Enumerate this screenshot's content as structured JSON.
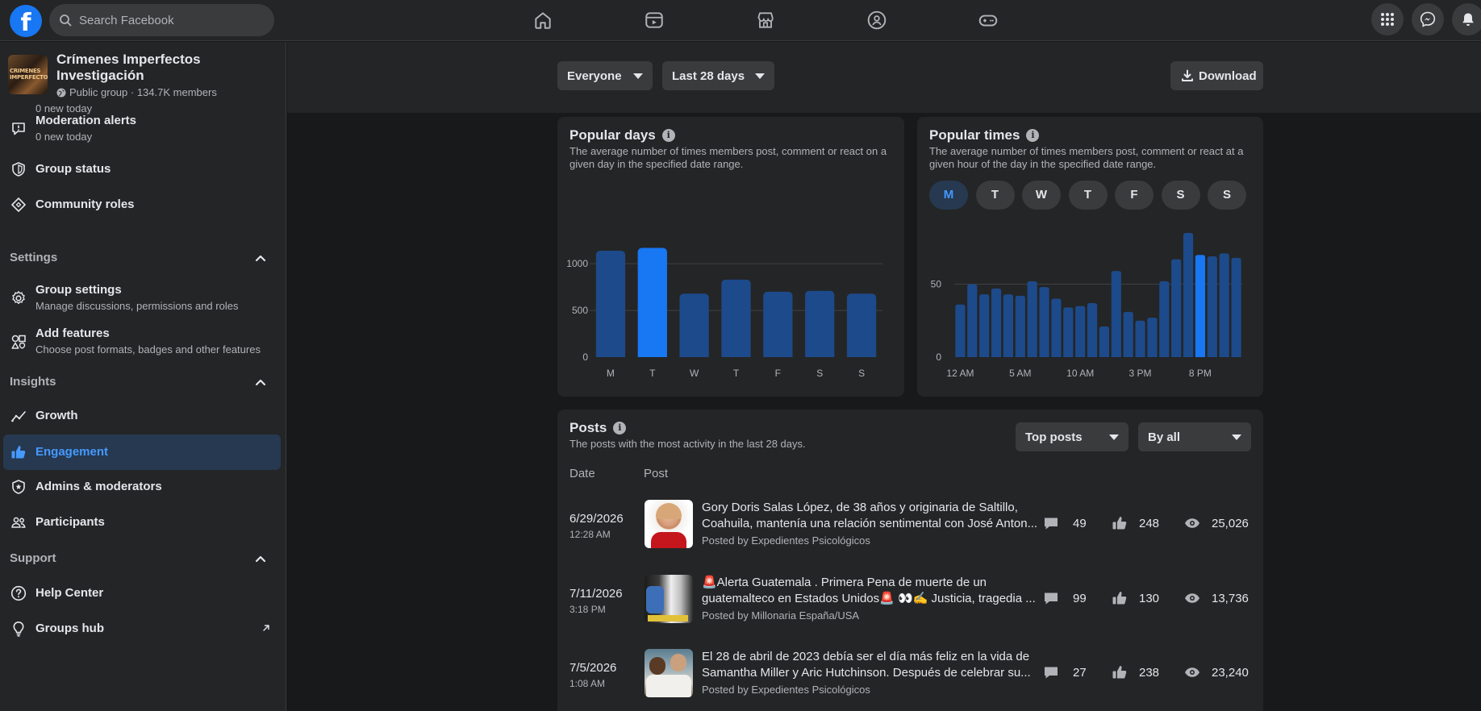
{
  "header": {
    "logo": "f",
    "search_placeholder": "Search Facebook",
    "nav_icons": [
      "home-icon",
      "video-icon",
      "marketplace-icon",
      "groups-icon",
      "gaming-icon"
    ],
    "right_icons": [
      "menu-grid-icon",
      "messenger-icon",
      "notifications-icon"
    ]
  },
  "group": {
    "name": "Crímenes Imperfectos Investigación",
    "thumb_text": "CRIMENES IMPERFECTOS",
    "meta": "Public group · 134.7K members",
    "cut_text": "0 new today"
  },
  "sidebar": {
    "moderation": {
      "label": "Moderation alerts",
      "sub": "0 new today"
    },
    "group_status": {
      "label": "Group status"
    },
    "community_roles": {
      "label": "Community roles"
    },
    "settings_title": "Settings",
    "group_settings": {
      "label": "Group settings",
      "sub": "Manage discussions, permissions and roles"
    },
    "add_features": {
      "label": "Add features",
      "sub": "Choose post formats, badges and other features"
    },
    "insights_title": "Insights",
    "growth": {
      "label": "Growth"
    },
    "engagement": {
      "label": "Engagement"
    },
    "admins": {
      "label": "Admins & moderators"
    },
    "participants": {
      "label": "Participants"
    },
    "support_title": "Support",
    "help_center": {
      "label": "Help Center"
    },
    "groups_hub": {
      "label": "Groups hub"
    }
  },
  "filters": {
    "audience": "Everyone",
    "range": "Last 28 days",
    "download": "Download"
  },
  "popular_days": {
    "title": "Popular days",
    "description": "The average number of times members post, comment or react on a given day in the specified date range."
  },
  "popular_times": {
    "title": "Popular times",
    "description": "The average number of times members post, comment or react at a given hour of the day in the specified date range.",
    "days": [
      "M",
      "T",
      "W",
      "T",
      "F",
      "S",
      "S"
    ],
    "selected_day": "M"
  },
  "chart_data": [
    {
      "type": "bar",
      "categories": [
        "M",
        "T",
        "W",
        "T",
        "F",
        "S",
        "S"
      ],
      "values": [
        1140,
        1170,
        680,
        830,
        700,
        710,
        680
      ],
      "highlight_index": 1,
      "yticks": [
        0,
        500,
        1000
      ],
      "ylim": [
        0,
        1200
      ],
      "grid": true,
      "colors": {
        "bar": "#1d4a8a",
        "highlight": "#1877f2"
      }
    },
    {
      "type": "bar",
      "categories": [
        "12 AM",
        "1 AM",
        "2 AM",
        "3 AM",
        "4 AM",
        "5 AM",
        "6 AM",
        "7 AM",
        "8 AM",
        "9 AM",
        "10 AM",
        "11 AM",
        "12 PM",
        "1 PM",
        "2 PM",
        "3 PM",
        "4 PM",
        "5 PM",
        "6 PM",
        "7 PM",
        "8 PM",
        "9 PM",
        "10 PM",
        "11 PM"
      ],
      "xtick_labels": [
        "12 AM",
        "5 AM",
        "10 AM",
        "3 PM",
        "8 PM"
      ],
      "xtick_indices": [
        0,
        5,
        10,
        15,
        20
      ],
      "values": [
        36,
        50,
        43,
        47,
        43,
        42,
        52,
        48,
        40,
        34,
        35,
        37,
        21,
        59,
        31,
        25,
        27,
        52,
        67,
        85,
        70,
        69,
        71,
        68
      ],
      "highlight_index": 20,
      "yticks": [
        0,
        50
      ],
      "ylim": [
        0,
        90
      ],
      "grid": true,
      "colors": {
        "bar": "#1d4a8a",
        "highlight": "#1877f2"
      }
    }
  ],
  "posts": {
    "title": "Posts",
    "description": "The posts with the most activity in the last 28 days.",
    "sort": "Top posts",
    "filter": "By all",
    "col_date": "Date",
    "col_post": "Post",
    "rows": [
      {
        "date": "6/29/2026",
        "time": "12:28 AM",
        "text": "Gory Doris Salas López, de 38 años y originaria de Saltillo, Coahuila, mantenía una relación sentimental con José Anton...",
        "by": "Posted by Expedientes Psicológicos",
        "comments": "49",
        "reactions": "248",
        "views": "25,026"
      },
      {
        "date": "7/11/2026",
        "time": "3:18 PM",
        "text": "🚨Alerta Guatemala . Primera Pena de muerte de un guatemalteco en Estados Unidos🚨 👀✍️ Justicia, tragedia ...",
        "by": "Posted by Millonaria España/USA",
        "comments": "99",
        "reactions": "130",
        "views": "13,736"
      },
      {
        "date": "7/5/2026",
        "time": "1:08 AM",
        "text": "El 28 de abril de 2023 debía ser el día más feliz en la vida de Samantha Miller y Aric Hutchinson. Después de celebrar su...",
        "by": "Posted by Expedientes Psicológicos",
        "comments": "27",
        "reactions": "238",
        "views": "23,240"
      }
    ]
  }
}
